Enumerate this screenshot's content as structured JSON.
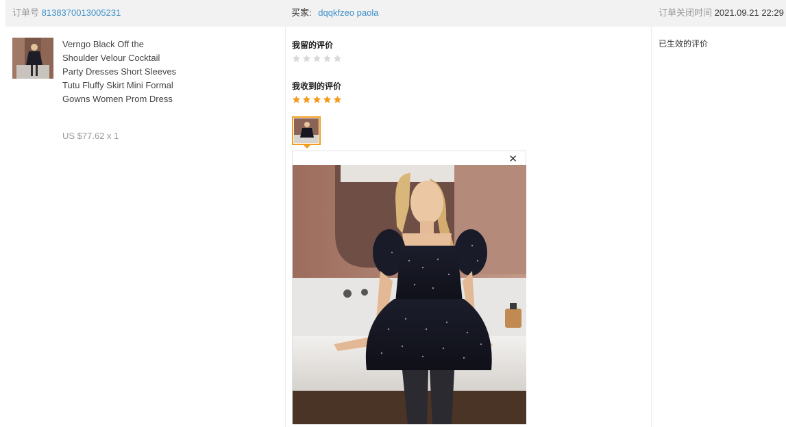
{
  "header": {
    "order_label": "订单号",
    "order_number": "8138370013005231",
    "buyer_label": "买家:",
    "buyer_name": "dqqkfzeo paola",
    "closed_label": "订单关闭时间",
    "closed_time": "2021.09.21 22:29"
  },
  "product": {
    "title": "Verngo Black Off the Shoulder Velour Cocktail Party Dresses Short Sleeves Tutu Fluffy Skirt Mini Formal Gowns Women Prom Dress",
    "price": "US $77.62 x 1"
  },
  "reviews": {
    "my_review_label": "我留的评价",
    "my_rating": 0,
    "received_label": "我收到的评价",
    "received_rating": 5,
    "effective_label": "已生效的评价"
  },
  "colors": {
    "accent": "#3a8fc8",
    "star_on": "#f29b1e",
    "star_off": "#d9d9d9"
  },
  "icons": {
    "close": "close-icon",
    "star": "star-icon"
  }
}
